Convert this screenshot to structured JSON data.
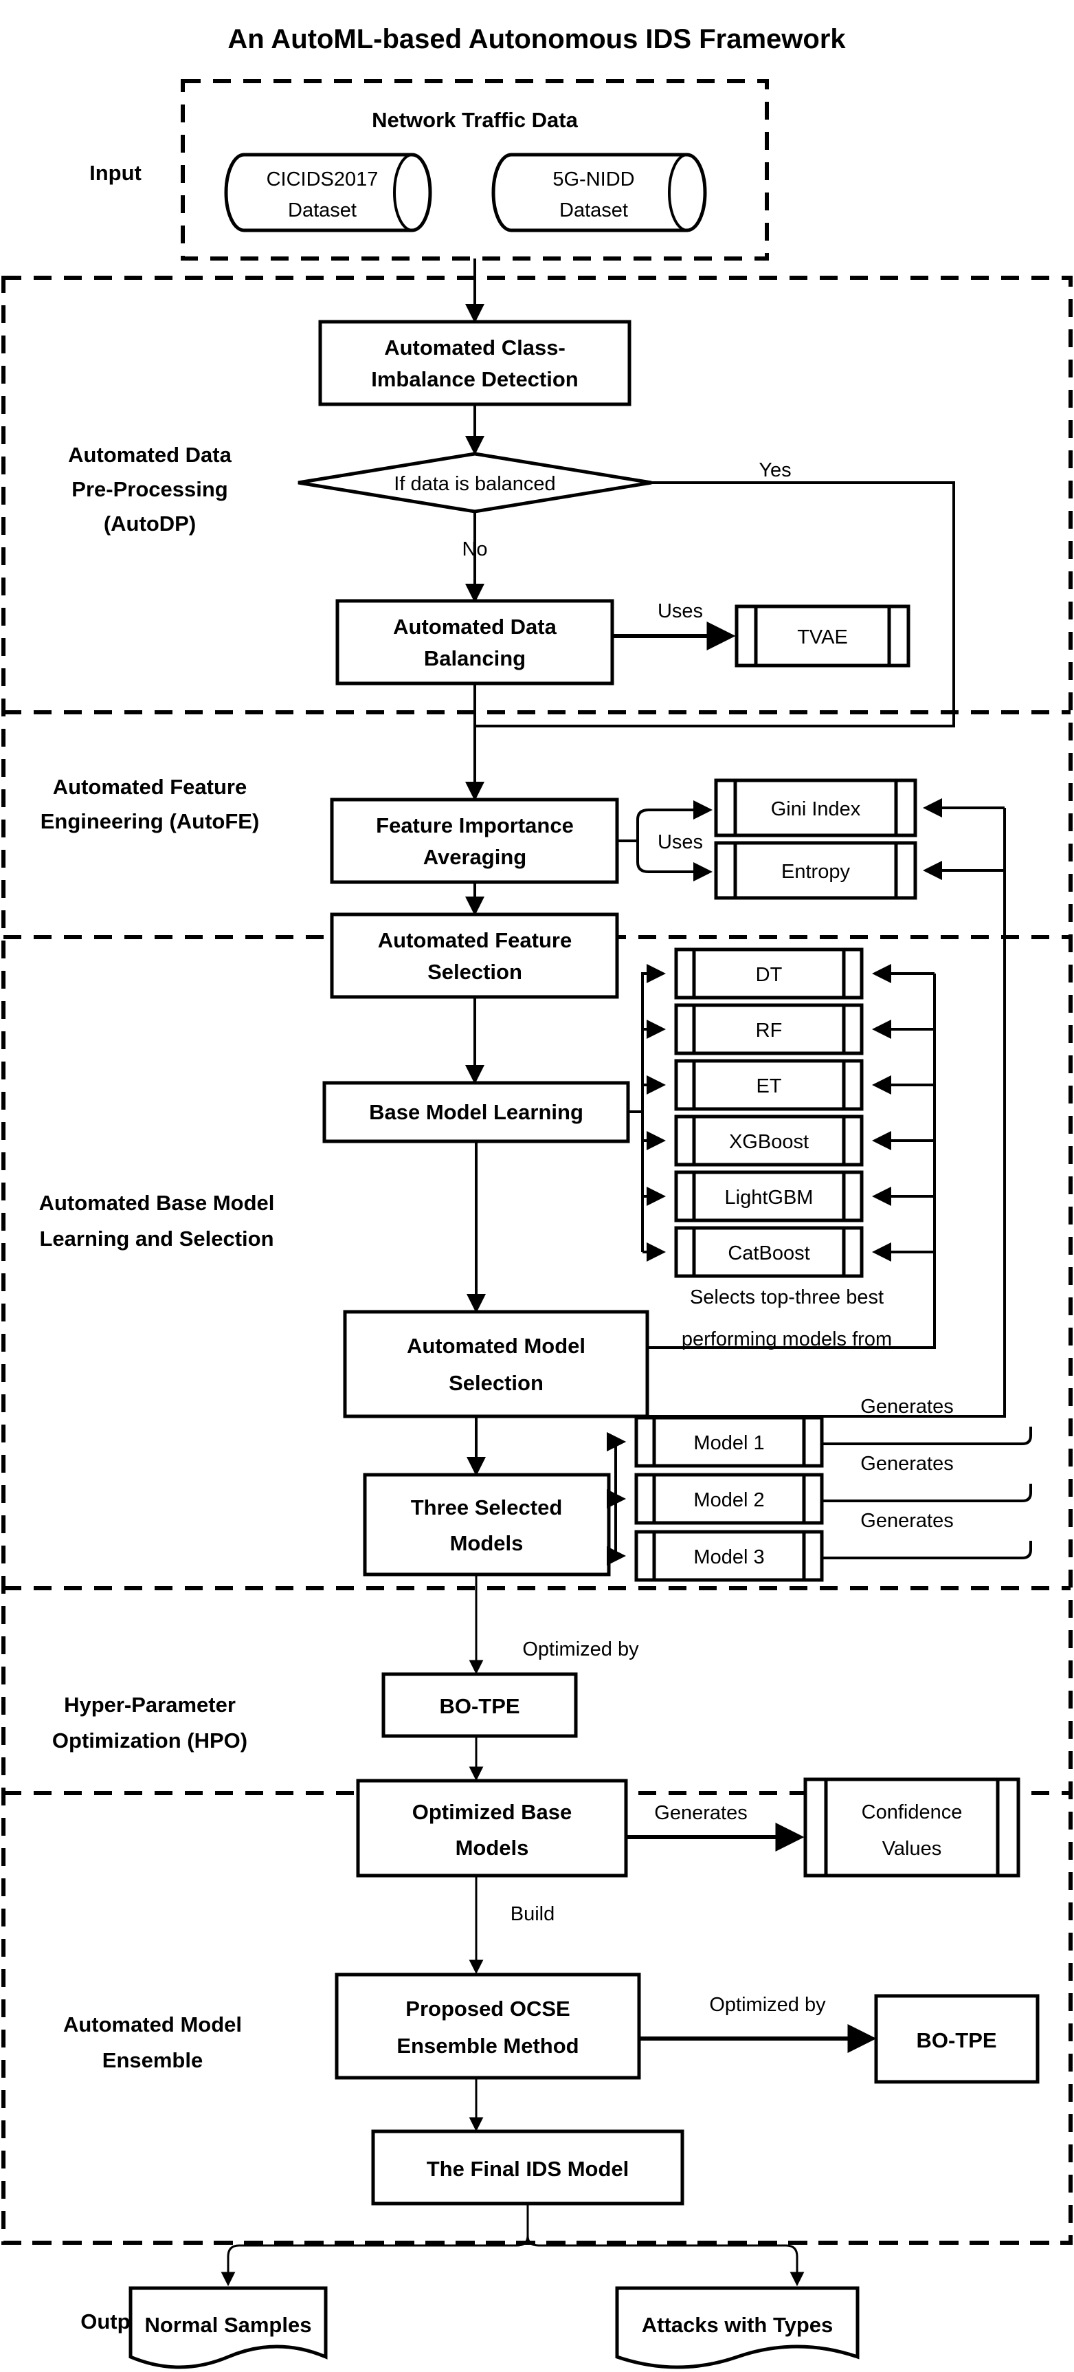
{
  "title": "An AutoML-based Autonomous IDS Framework",
  "stage_labels": {
    "input": "Input",
    "autodp_1": "Automated Data",
    "autodp_2": "Pre-Processing",
    "autodp_3": "(AutoDP)",
    "autofe_1": "Automated Feature",
    "autofe_2": "Engineering (AutoFE)",
    "base_1": "Automated Base Model",
    "base_2": "Learning and Selection",
    "hpo_1": "Hyper-Parameter",
    "hpo_2": "Optimization (HPO)",
    "ensemble_1": "Automated Model",
    "ensemble_2": "Ensemble",
    "output": "Output"
  },
  "input_section": {
    "heading": "Network Traffic Data",
    "datasets": [
      {
        "line1": "CICIDS2017",
        "line2": "Dataset"
      },
      {
        "line1": "5G-NIDD",
        "line2": "Dataset"
      }
    ]
  },
  "autodp": {
    "imbalance_box_l1": "Automated Class-",
    "imbalance_box_l2": "Imbalance Detection",
    "decision": "If data is balanced",
    "yes_label": "Yes",
    "no_label": "No",
    "balancing_l1": "Automated Data",
    "balancing_l2": "Balancing",
    "uses_label": "Uses",
    "tvae": "TVAE"
  },
  "autofe": {
    "importance_l1": "Feature Importance",
    "importance_l2": "Averaging",
    "uses_label": "Uses",
    "criteria": [
      "Gini Index",
      "Entropy"
    ],
    "selection_l1": "Automated Feature",
    "selection_l2": "Selection"
  },
  "base_model": {
    "learning_box": "Base Model Learning",
    "models": [
      "DT",
      "RF",
      "ET",
      "XGBoost",
      "LightGBM",
      "CatBoost"
    ],
    "selects_l1": "Selects top-three best",
    "selects_l2": "performing models from",
    "selection_l1": "Automated Model",
    "selection_l2": "Selection",
    "three_l1": "Three Selected",
    "three_l2": "Models",
    "selected_models": [
      "Model 1",
      "Model 2",
      "Model 3"
    ],
    "generates_label": "Generates"
  },
  "hpo": {
    "optimized_by_label": "Optimized by",
    "botpe": "BO-TPE",
    "optimized_base_l1": "Optimized Base",
    "optimized_base_l2": "Models",
    "generates_label": "Generates",
    "confidence_l1": "Confidence",
    "confidence_l2": "Values"
  },
  "ensemble": {
    "build_label": "Build",
    "ocse_l1": "Proposed OCSE",
    "ocse_l2": "Ensemble Method",
    "optimized_by_label": "Optimized by",
    "botpe": "BO-TPE",
    "final_model": "The Final IDS Model"
  },
  "output_section": {
    "docs": [
      "Normal Samples",
      "Attacks with Types"
    ]
  },
  "colors": {
    "stroke": "#000000",
    "fill": "#ffffff",
    "background": "#ffffff"
  }
}
